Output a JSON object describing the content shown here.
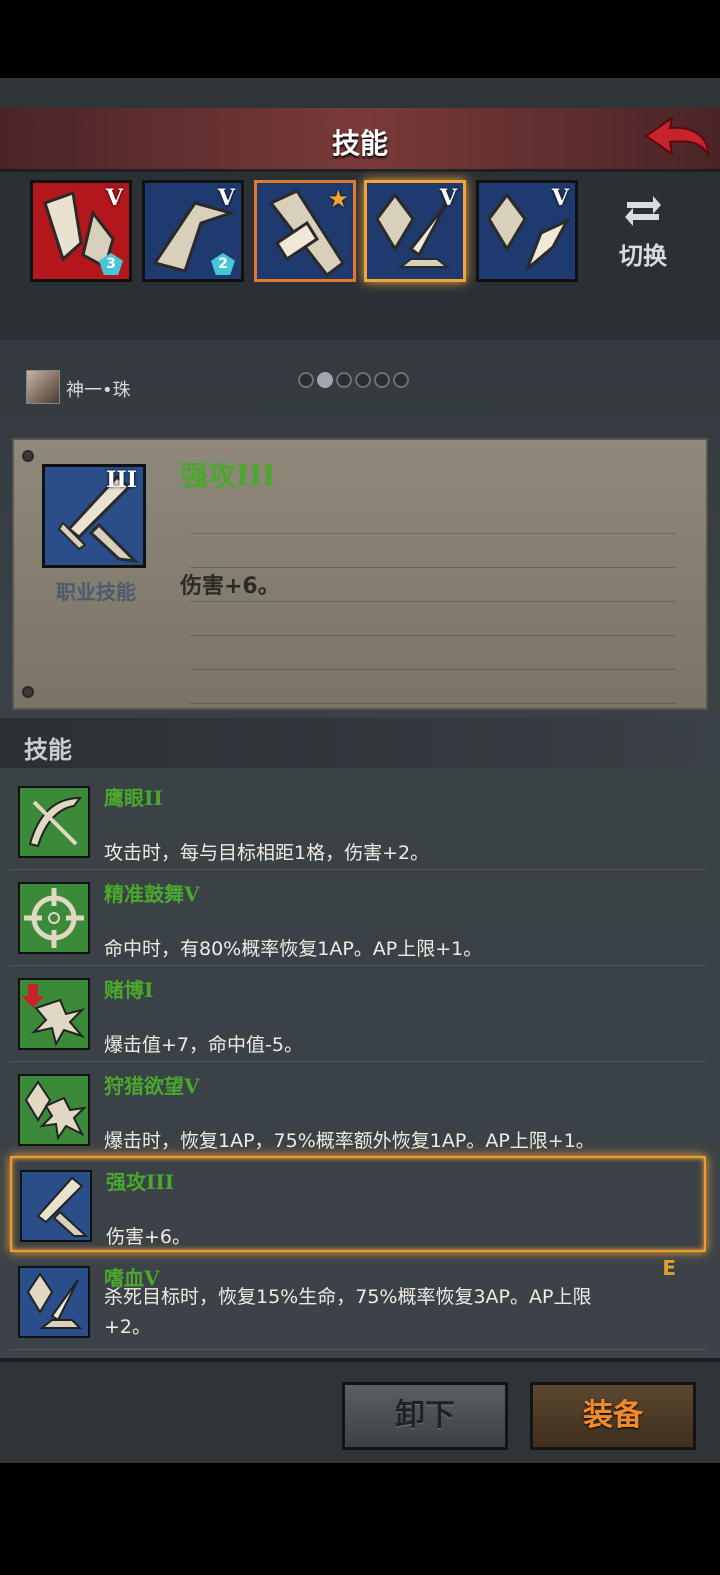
{
  "header": {
    "title": "技能"
  },
  "slots": [
    {
      "rank": "V",
      "gem": "3",
      "color": "red"
    },
    {
      "rank": "V",
      "gem": "2",
      "color": "blue"
    },
    {
      "rank": "",
      "star": "★",
      "color": "blue",
      "state": "selected-orange"
    },
    {
      "rank": "V",
      "color": "blue",
      "state": "selected-glow"
    },
    {
      "rank": "V",
      "color": "blue"
    }
  ],
  "switch": {
    "label": "切换"
  },
  "character": {
    "name": "神一•珠"
  },
  "pager": {
    "count": 6,
    "active": 1
  },
  "detail": {
    "name": "强攻III",
    "rank": "III",
    "type": "职业技能",
    "description": "伤害+6。"
  },
  "section": {
    "title": "技能"
  },
  "skills": [
    {
      "name": "鹰眼II",
      "description": "攻击时，每与目标相距1格，伤害+2。",
      "icon": "bow-icon",
      "color": "green"
    },
    {
      "name": "精准鼓舞V",
      "description": "命中时，有80%概率恢复1AP。AP上限+1。",
      "icon": "crosshair-icon",
      "color": "green"
    },
    {
      "name": "赌博I",
      "description": "爆击值+7，命中值-5。",
      "icon": "gamble-icon",
      "color": "green"
    },
    {
      "name": "狩猎欲望V",
      "description": "爆击时，恢复1AP，75%概率额外恢复1AP。AP上限+1。",
      "icon": "hunt-icon",
      "color": "green"
    },
    {
      "name": "强攻III",
      "description": "伤害+6。",
      "icon": "sword-icon",
      "color": "blue",
      "selected": true
    },
    {
      "name": "嗜血V",
      "description": "杀死目标时，恢复15%生命，75%概率恢复3AP。AP上限+2。",
      "icon": "bloodlust-icon",
      "color": "blue",
      "tag": "E"
    }
  ],
  "buttons": {
    "unequip": "卸下",
    "equip": "装备"
  },
  "colors": {
    "accent": "#f08a2a",
    "skill_name": "#4aa82c",
    "selection": "#f29a2b"
  }
}
